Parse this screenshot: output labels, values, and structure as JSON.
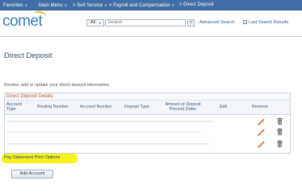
{
  "topnav": {
    "items": [
      {
        "label": "Favorites",
        "has_menu": true
      },
      {
        "label": "Main Menu",
        "has_menu": true
      },
      {
        "label": "> Self Service",
        "has_menu": true
      },
      {
        "label": "> Payroll and Compensation",
        "has_menu": true
      },
      {
        "label": "> Direct Deposit",
        "has_menu": false
      }
    ]
  },
  "header": {
    "logo_text": "comet",
    "search_scope": "All",
    "search_placeholder": "Search",
    "advanced_search_label": "Advanced Search",
    "last_results_label": "Last Search Results"
  },
  "page": {
    "title": "Direct Deposit",
    "intro": "Review, add or update your direct deposit information."
  },
  "grid": {
    "title": "Direct Deposit Details",
    "columns": {
      "account_type": "Account Type",
      "routing_number": "Routing Number",
      "account_number": "Account Number",
      "deposit_type": "Deposit Type",
      "amount_percent": "Amount or Deposit Percent Order",
      "edit": "Edit",
      "remove": "Remove"
    },
    "row_count": 3
  },
  "footer": {
    "pay_statement_link": "Pay Statement Print Options",
    "add_account_button": "Add Account"
  },
  "colors": {
    "nav_bar": "#3f6fa6",
    "logo_blue": "#3a7ebd",
    "logo_arc": "#f0b21a",
    "grid_title": "#c0632c",
    "highlight": "#f6f21c",
    "edit_icon": "#e07c1e",
    "remove_icon": "#555555"
  }
}
